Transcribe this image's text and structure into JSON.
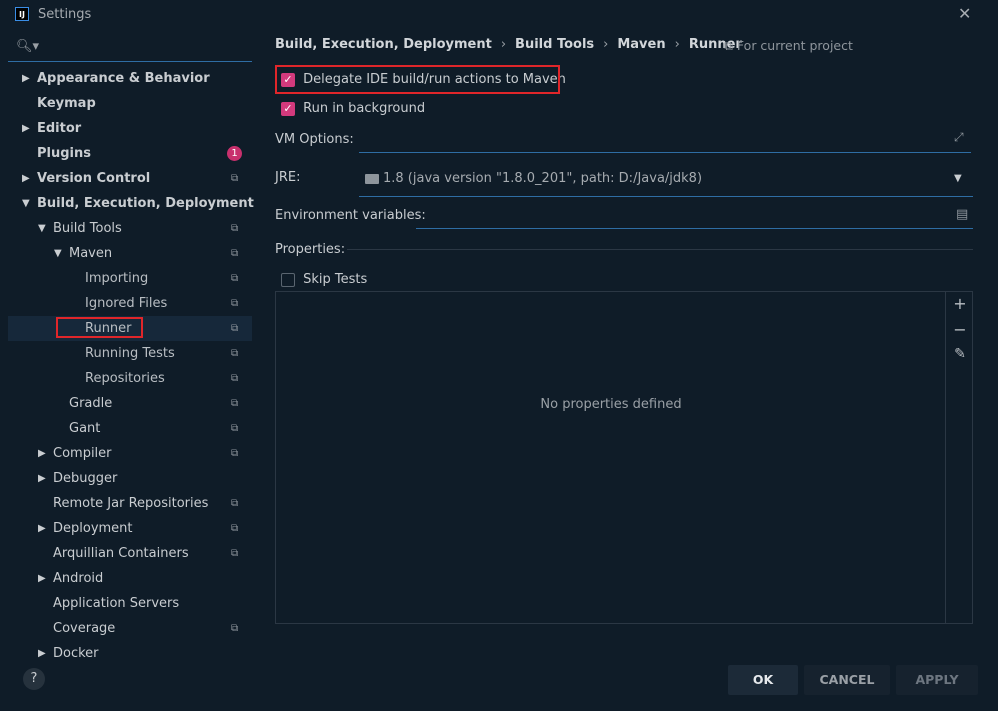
{
  "window": {
    "title": "Settings",
    "app_icon_text": "IJ"
  },
  "search": {
    "placeholder": ""
  },
  "sidebar": {
    "items": [
      {
        "label": "Appearance & Behavior",
        "level": 0,
        "arrow": "right",
        "bold": true,
        "proj": false
      },
      {
        "label": "Keymap",
        "level": 0,
        "arrow": "",
        "bold": true,
        "proj": false
      },
      {
        "label": "Editor",
        "level": 0,
        "arrow": "right",
        "bold": true,
        "proj": false
      },
      {
        "label": "Plugins",
        "level": 0,
        "arrow": "",
        "bold": true,
        "proj": false,
        "badge": "1"
      },
      {
        "label": "Version Control",
        "level": 0,
        "arrow": "right",
        "bold": true,
        "proj": true
      },
      {
        "label": "Build, Execution, Deployment",
        "level": 0,
        "arrow": "down",
        "bold": true,
        "proj": false
      },
      {
        "label": "Build Tools",
        "level": 1,
        "arrow": "down",
        "bold": false,
        "proj": true
      },
      {
        "label": "Maven",
        "level": 2,
        "arrow": "down",
        "bold": false,
        "proj": true
      },
      {
        "label": "Importing",
        "level": 3,
        "arrow": "",
        "bold": false,
        "proj": true
      },
      {
        "label": "Ignored Files",
        "level": 3,
        "arrow": "",
        "bold": false,
        "proj": true
      },
      {
        "label": "Runner",
        "level": 3,
        "arrow": "",
        "bold": false,
        "proj": true,
        "selected": true
      },
      {
        "label": "Running Tests",
        "level": 3,
        "arrow": "",
        "bold": false,
        "proj": true
      },
      {
        "label": "Repositories",
        "level": 3,
        "arrow": "",
        "bold": false,
        "proj": true
      },
      {
        "label": "Gradle",
        "level": 2,
        "arrow": "",
        "bold": false,
        "proj": true
      },
      {
        "label": "Gant",
        "level": 2,
        "arrow": "",
        "bold": false,
        "proj": true
      },
      {
        "label": "Compiler",
        "level": 1,
        "arrow": "right",
        "bold": false,
        "proj": true
      },
      {
        "label": "Debugger",
        "level": 1,
        "arrow": "right",
        "bold": false,
        "proj": false
      },
      {
        "label": "Remote Jar Repositories",
        "level": 1,
        "arrow": "",
        "bold": false,
        "proj": true
      },
      {
        "label": "Deployment",
        "level": 1,
        "arrow": "right",
        "bold": false,
        "proj": true
      },
      {
        "label": "Arquillian Containers",
        "level": 1,
        "arrow": "",
        "bold": false,
        "proj": true
      },
      {
        "label": "Android",
        "level": 1,
        "arrow": "right",
        "bold": false,
        "proj": false
      },
      {
        "label": "Application Servers",
        "level": 1,
        "arrow": "",
        "bold": false,
        "proj": false
      },
      {
        "label": "Coverage",
        "level": 1,
        "arrow": "",
        "bold": false,
        "proj": true
      },
      {
        "label": "Docker",
        "level": 1,
        "arrow": "right",
        "bold": false,
        "proj": false
      }
    ]
  },
  "breadcrumb": {
    "items": [
      "Build, Execution, Deployment",
      "Build Tools",
      "Maven",
      "Runner"
    ],
    "scope": "For current project"
  },
  "options": {
    "delegate_label": "Delegate IDE build/run actions to Maven",
    "delegate_checked": true,
    "background_label": "Run in background",
    "background_checked": true,
    "vm_label": "VM Options:",
    "vm_value": "",
    "jre_label": "JRE:",
    "jre_value": "1.8 (java version \"1.8.0_201\", path: D:/Java/jdk8)",
    "env_label": "Environment variables:",
    "env_value": "",
    "properties_label": "Properties:",
    "skip_tests_label": "Skip Tests",
    "skip_tests_checked": false,
    "empty_text": "No properties defined"
  },
  "buttons": {
    "ok": "OK",
    "cancel": "CANCEL",
    "apply": "APPLY",
    "help": "?"
  },
  "colors": {
    "accent": "#d33a7d",
    "highlight": "#e0262a",
    "background": "#0f1c28",
    "focus_line": "#2e6da4"
  }
}
